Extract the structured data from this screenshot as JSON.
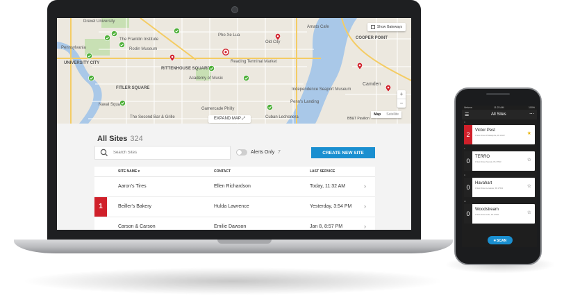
{
  "colors": {
    "accent": "#1a8fd0",
    "alert": "#d0202a",
    "pin_green": "#4caf37",
    "pin_red": "#d0202a",
    "water": "#a9c8e8",
    "park": "#c8e0b4"
  },
  "map": {
    "labels": [
      {
        "text": "Drexel University",
        "name": "label-drexel"
      },
      {
        "text": "Pennsylvania",
        "name": "label-penn"
      },
      {
        "text": "UNIVERSITY CITY",
        "name": "label-ucity"
      },
      {
        "text": "The Franklin Institute",
        "name": "label-franklin"
      },
      {
        "text": "Rodin Museum",
        "name": "label-rodin"
      },
      {
        "text": "Reading Terminal Market",
        "name": "label-reading"
      },
      {
        "text": "RITTENHOUSE SQUARE",
        "name": "label-rittenhouse"
      },
      {
        "text": "Academy of Music",
        "name": "label-academy"
      },
      {
        "text": "FITLER SQUARE",
        "name": "label-fitler"
      },
      {
        "text": "Naval Square",
        "name": "label-naval"
      },
      {
        "text": "The Second Bar & Grille",
        "name": "label-second"
      },
      {
        "text": "Gamercade Philly",
        "name": "label-gamercade"
      },
      {
        "text": "Independence Seaport Museum",
        "name": "label-seaport"
      },
      {
        "text": "COOPER POINT",
        "name": "label-cooper"
      },
      {
        "text": "Camden",
        "name": "label-camden"
      },
      {
        "text": "Pho Xe Lua",
        "name": "label-pho"
      },
      {
        "text": "Amato Cafe",
        "name": "label-amato"
      },
      {
        "text": "Old City",
        "name": "label-oldcity"
      },
      {
        "text": "Penn's Landing",
        "name": "label-penns"
      },
      {
        "text": "Cuban Lechonera",
        "name": "label-cuban"
      }
    ],
    "show_gateways": "Show Gateways",
    "map_type_map": "Map",
    "map_type_satellite": "Satellite",
    "zoom_in": "+",
    "zoom_out": "−",
    "expand": "EXPAND MAP ⤢",
    "attribution": "BB&T Pavilion"
  },
  "sites": {
    "title": "All Sites",
    "count": "324",
    "search_placeholder": "Search Sites",
    "alerts_only_label": "Alerts Only",
    "alerts_count": "7",
    "create_button": "CREATE NEW SITE",
    "columns": {
      "name": "SITE NAME ▾",
      "contact": "CONTACT",
      "last_service": "LAST SERVICE"
    },
    "rows": [
      {
        "name": "Aaron's Tires",
        "contact": "Ellen Richardson",
        "last_service": "Today, 11:32 AM",
        "alerts": ""
      },
      {
        "name": "Beiller's Bakery",
        "contact": "Hulda Lawrence",
        "last_service": "Yesterday, 3:54 PM",
        "alerts": "1"
      },
      {
        "name": "Carson & Carson",
        "contact": "Emilie Dawson",
        "last_service": "Jan 8, 8:57 PM",
        "alerts": ""
      }
    ]
  },
  "phone": {
    "status_left": "Verizon",
    "status_time": "11:23 AM",
    "status_right": "100%",
    "title": "All Sites",
    "menu_icon": "☰",
    "more_icon": "⋯",
    "sections": [
      "V",
      "T",
      "H",
      "W"
    ],
    "cards": [
      {
        "count": "2",
        "name": "Victor Pest",
        "address": "1 Main Street Philadelphia, PA 19107",
        "starred": true
      },
      {
        "count": "0",
        "name": "TERRO",
        "address": "1 Main Street Sample, PA 17543",
        "starred": false
      },
      {
        "count": "0",
        "name": "Havahart",
        "address": "1 Main Street Lancaster, PA 17543",
        "starred": false
      },
      {
        "count": "0",
        "name": "Woodstream",
        "address": "1 Main Street Lititz, PA 17543",
        "starred": false
      }
    ],
    "scan_button": "⌗ SCAN"
  }
}
